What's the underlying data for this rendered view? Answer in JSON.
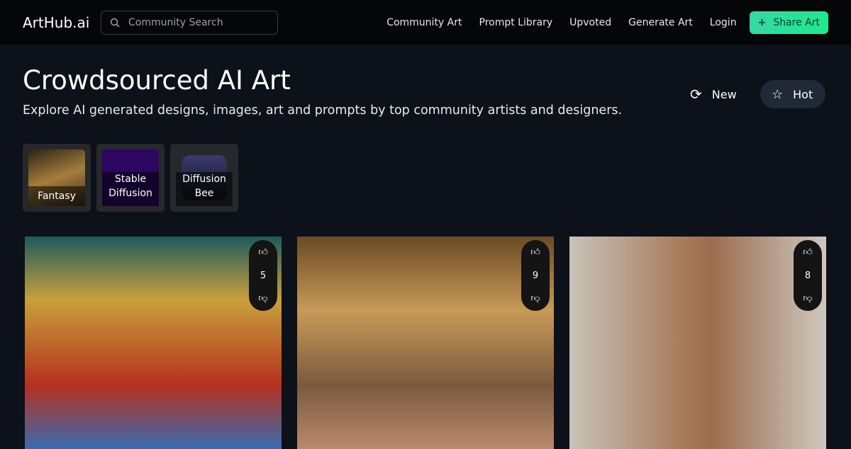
{
  "nav": {
    "logo": "ArtHub.ai",
    "search_placeholder": "Community Search",
    "links": [
      "Community Art",
      "Prompt Library",
      "Upvoted",
      "Generate Art",
      "Login"
    ],
    "share": "Share Art"
  },
  "hero": {
    "title": "Crowdsourced AI Art",
    "subtitle": "Explore AI generated designs, images, art and prompts by top community artists and designers.",
    "sort_new": "New",
    "sort_hot": "Hot",
    "active_sort": "Hot"
  },
  "categories": [
    {
      "label": "Fantasy"
    },
    {
      "label": "Stable Diffusion"
    },
    {
      "label": "Diffusion Bee"
    }
  ],
  "cards": [
    {
      "votes": "5"
    },
    {
      "votes": "9"
    },
    {
      "votes": "8"
    }
  ],
  "colors": {
    "accent": "#2ee0a0",
    "background": "#0d1119",
    "nav": "#050608"
  }
}
